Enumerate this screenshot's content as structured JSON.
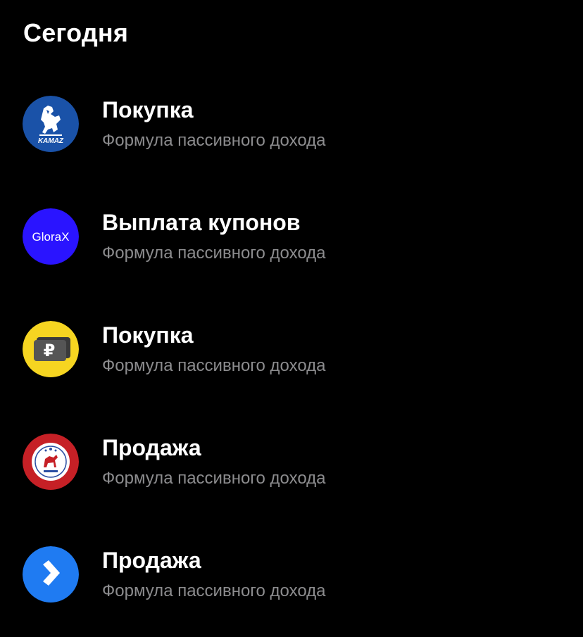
{
  "header": {
    "title": "Сегодня"
  },
  "operations": [
    {
      "title": "Покупка",
      "subtitle": "Формула пассивного дохода",
      "logo": {
        "icon": "kamaz-logo-icon",
        "caption": "KAMAZ",
        "bg": "#1a52a8"
      }
    },
    {
      "title": "Выплата купонов",
      "subtitle": "Формула пассивного дохода",
      "logo": {
        "icon": "glorax-logo-icon",
        "caption": "GloraX",
        "bg": "#2a14ff"
      }
    },
    {
      "title": "Покупка",
      "subtitle": "Формула пассивного дохода",
      "logo": {
        "icon": "ruble-wallet-icon",
        "caption": "₽",
        "bg": "#f6d521"
      }
    },
    {
      "title": "Продажа",
      "subtitle": "Формула пассивного дохода",
      "logo": {
        "icon": "yakutia-emblem-icon",
        "bg": "#c62026"
      }
    },
    {
      "title": "Продажа",
      "subtitle": "Формула пассивного дохода",
      "logo": {
        "icon": "blue-arrow-logo-icon",
        "bg": "#1f7bf2"
      }
    }
  ]
}
